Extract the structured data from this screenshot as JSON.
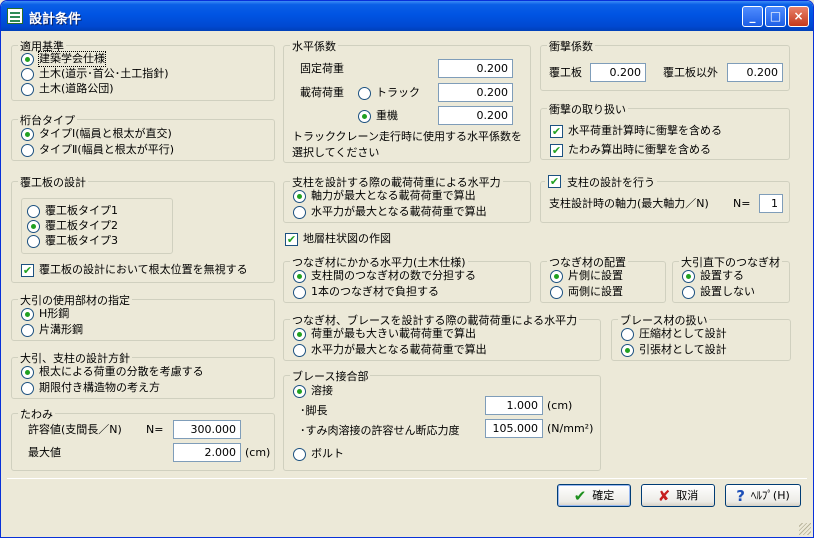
{
  "title": "設計条件",
  "titlebar": {
    "min": "_",
    "max": "□",
    "close": "×"
  },
  "teki": {
    "legend": "適用基準",
    "o1": "建築学会仕様",
    "o2": "土木(道示･首公･土工指針)",
    "o3": "土木(道路公団)"
  },
  "keta": {
    "legend": "桁台タイプ",
    "o1": "タイプⅠ(幅員と根太が直交)",
    "o2": "タイプⅡ(幅員と根太が平行)"
  },
  "fuku": {
    "legend": "覆工板の設計",
    "o1": "覆工板タイプ1",
    "o2": "覆工板タイプ2",
    "o3": "覆工板タイプ3",
    "chk": "覆工板の設計において根太位置を無視する"
  },
  "ohiki": {
    "legend": "大引の使用部材の指定",
    "o1": "H形鋼",
    "o2": "片溝形鋼"
  },
  "hoshin": {
    "legend": "大引、支柱の設計方針",
    "o1": "根太による荷重の分散を考慮する",
    "o2": "期限付き構造物の考え方"
  },
  "tawami": {
    "legend": "たわみ",
    "l1": "許容値(支間長／N)",
    "n": "N=",
    "v1": "300.000",
    "l2": "最大値",
    "v2": "2.000",
    "u2": "(cm)"
  },
  "suihei": {
    "legend": "水平係数",
    "kotei": "固定荷重",
    "v1": "0.200",
    "saika": "載荷荷重",
    "truck": "トラック",
    "v2": "0.200",
    "juki": "重機",
    "v3": "0.200",
    "note1": "トラッククレーン走行時に使用する水平係数を",
    "note2": "選択してください"
  },
  "shichu": {
    "legend": "支柱を設計する際の載荷荷重による水平力",
    "o1": "軸力が最大となる載荷荷重で算出",
    "o2": "水平力が最大となる載荷荷重で算出"
  },
  "chiso": "地層柱状図の作図",
  "tsunagi": {
    "legend": "つなぎ材にかかる水平力(土木仕様)",
    "o1": "支柱間のつなぎ材の数で分担する",
    "o2": "1本のつなぎ材で負担する"
  },
  "haichi": {
    "legend": "つなぎ材の配置",
    "o1": "片側に設置",
    "o2": "両側に設置"
  },
  "ohikika": {
    "legend": "大引直下のつなぎ材",
    "o1": "設置する",
    "o2": "設置しない"
  },
  "brace": {
    "legend": "つなぎ材、ブレースを設計する際の載荷荷重による水平力",
    "o1": "荷重が最も大きい載荷荷重で算出",
    "o2": "水平力が最大となる載荷荷重で算出"
  },
  "brazai": {
    "legend": "ブレース材の扱い",
    "o1": "圧縮材として設計",
    "o2": "引張材として設計"
  },
  "setsugo": {
    "legend": "ブレース接合部",
    "o1": "溶接",
    "kyacho": "･脚長",
    "v1": "1.000",
    "u1": "(cm)",
    "sumi": "･すみ肉溶接の許容せん断応力度",
    "v2": "105.000",
    "u2": "(N/mm²)",
    "o2": "ボルト"
  },
  "shogeki": {
    "legend": "衝撃係数",
    "l1": "覆工板",
    "v1": "0.200",
    "l2": "覆工板以外",
    "v2": "0.200"
  },
  "shogekiatsukai": {
    "legend": "衝撃の取り扱い",
    "c1": "水平荷重計算時に衝撃を含める",
    "c2": "たわみ算出時に衝撃を含める"
  },
  "shichuset": {
    "chk": "支柱の設計を行う",
    "label": "支柱設計時の軸力(最大軸力／N)",
    "n": "N=",
    "v": "1"
  },
  "buttons": {
    "ok": "確定",
    "cancel": "取消",
    "help": "ﾍﾙﾌﾟ(H)"
  }
}
